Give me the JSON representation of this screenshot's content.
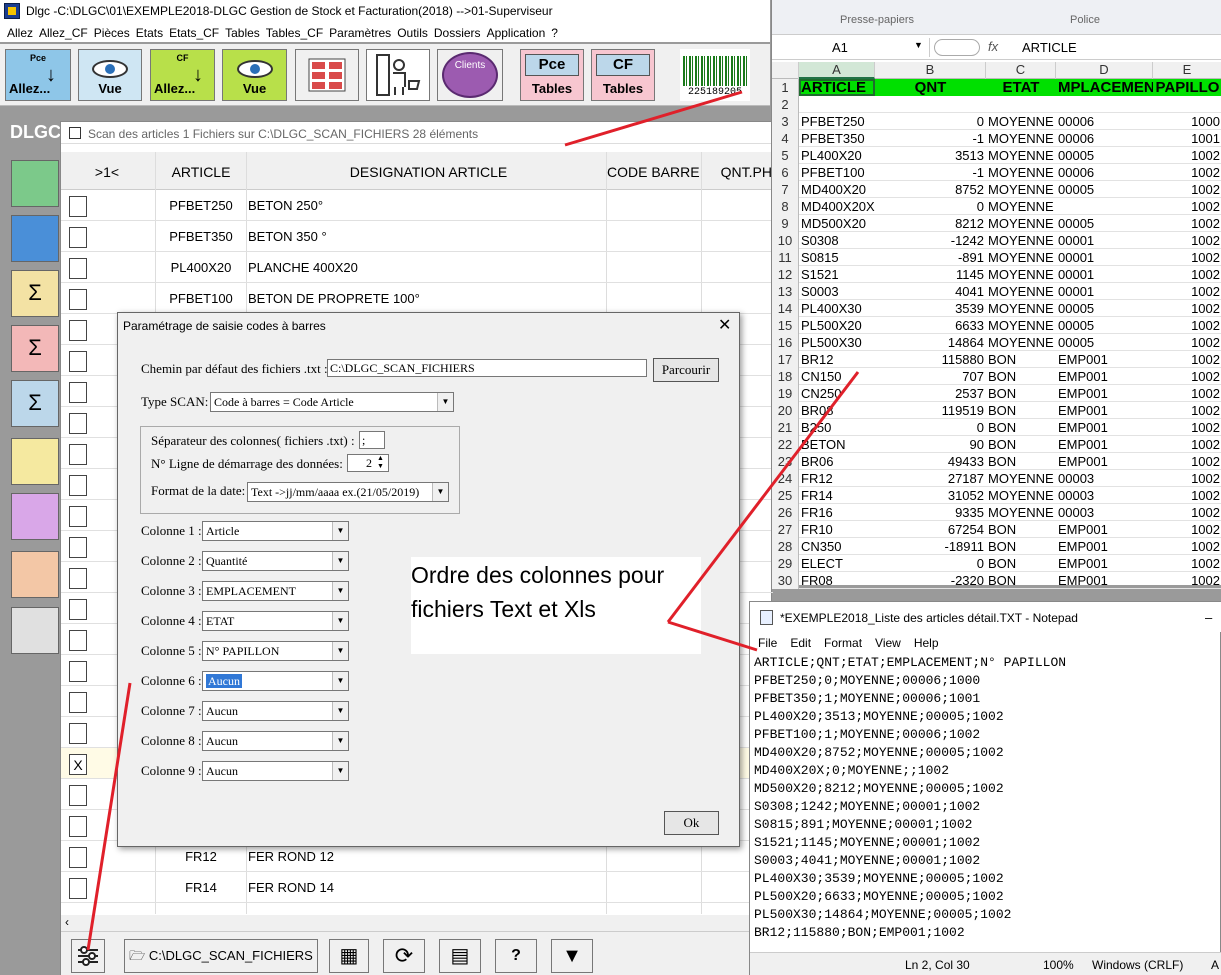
{
  "app": {
    "title": "Dlgc -C:\\DLGC\\01\\EXEMPLE2018-DLGC Gestion de Stock et Facturation(2018) -->01-Superviseur",
    "brand_label": "DLGC",
    "menu": [
      "Allez",
      "Allez_CF",
      "Pièces",
      "Etats",
      "Etats_CF",
      "Tables",
      "Tables_CF",
      "Paramètres",
      "Outils",
      "Dossiers",
      "Application",
      "?"
    ]
  },
  "toolbar": {
    "allez_pce_small": "Pce",
    "allez_pce_label": "Allez...",
    "vue_label": "Vue",
    "allez_cf_small": "CF",
    "allez_cf_label": "Allez...",
    "vue_cf_label": "Vue",
    "clients_label": "Clients",
    "pce_tables_top": "Pce",
    "pce_tables_bottom": "Tables",
    "cf_tables_top": "CF",
    "cf_tables_bottom": "Tables",
    "barcode_number": "225189205"
  },
  "scan_window": {
    "title": "Scan des articles 1  Fichiers sur C:\\DLGC_SCAN_FICHIERS   28 éléments",
    "columns": [
      ">1<",
      "ARTICLE",
      "DESIGNATION ARTICLE",
      "CODE BARRES",
      "QNT.PHY"
    ],
    "rows_top": [
      {
        "article": "PFBET250",
        "designation": "BETON 250°"
      },
      {
        "article": "PFBET350",
        "designation": "BETON 350 °"
      },
      {
        "article": "PL400X20",
        "designation": "PLANCHE 400X20"
      },
      {
        "article": "PFBET100",
        "designation": "BETON DE PROPRETE 100°"
      }
    ],
    "checked_mark": "X",
    "rows_bottom": [
      {
        "article": "FR12",
        "designation": "FER ROND 12"
      },
      {
        "article": "FR14",
        "designation": "FER ROND 14"
      }
    ],
    "folder_button": "C:\\DLGC_SCAN_FICHIERS",
    "help_button": "?"
  },
  "dialog": {
    "title": "Paramétrage de saisie codes à barres",
    "close": "✕",
    "path_label": "Chemin par défaut des fichiers .txt :",
    "path_value": "C:\\DLGC_SCAN_FICHIERS",
    "browse_button": "Parcourir",
    "type_label": "Type SCAN:",
    "type_value": "Code à barres = Code Article",
    "separator_label": "Séparateur des colonnes( fichiers .txt) :",
    "separator_value": ";",
    "start_line_label": "N° Ligne de démarrage des données:",
    "start_line_value": "2",
    "date_format_label": "Format de la date:",
    "date_format_value": "Text ->jj/mm/aaaa ex.(21/05/2019)",
    "columns": [
      {
        "label": "Colonne 1 :",
        "value": "Article"
      },
      {
        "label": "Colonne 2 :",
        "value": "Quantité"
      },
      {
        "label": "Colonne 3 :",
        "value": "EMPLACEMENT"
      },
      {
        "label": "Colonne 4 :",
        "value": "ETAT"
      },
      {
        "label": "Colonne 5 :",
        "value": "N° PAPILLON"
      },
      {
        "label": "Colonne 6 :",
        "value": "Aucun"
      },
      {
        "label": "Colonne 7 :",
        "value": "Aucun"
      },
      {
        "label": "Colonne 8 :",
        "value": "Aucun"
      },
      {
        "label": "Colonne 9 :",
        "value": "Aucun"
      }
    ],
    "ok_button": "Ok"
  },
  "annotation": {
    "line1": "Ordre des colonnes pour",
    "line2": "fichiers Text et Xls"
  },
  "excel": {
    "ribbon_left": "Presse-papiers",
    "ribbon_right": "Police",
    "name_box": "A1",
    "fx": "fx",
    "formula": "ARTICLE",
    "col_letters": [
      "A",
      "B",
      "C",
      "D",
      "E"
    ],
    "header_row": [
      "ARTICLE",
      "QNT",
      "ETAT",
      "MPLACEMEN",
      "PAPILLO"
    ],
    "rows": [
      [
        "",
        "",
        "",
        "",
        ""
      ],
      [
        "PFBET250",
        "0",
        "MOYENNE",
        "00006",
        "1000"
      ],
      [
        "PFBET350",
        "-1",
        "MOYENNE",
        "00006",
        "1001"
      ],
      [
        "PL400X20",
        "3513",
        "MOYENNE",
        "00005",
        "1002"
      ],
      [
        "PFBET100",
        "-1",
        "MOYENNE",
        "00006",
        "1002"
      ],
      [
        "MD400X20",
        "8752",
        "MOYENNE",
        "00005",
        "1002"
      ],
      [
        "MD400X20X",
        "0",
        "MOYENNE",
        "",
        "1002"
      ],
      [
        "MD500X20",
        "8212",
        "MOYENNE",
        "00005",
        "1002"
      ],
      [
        "S0308",
        "-1242",
        "MOYENNE",
        "00001",
        "1002"
      ],
      [
        "S0815",
        "-891",
        "MOYENNE",
        "00001",
        "1002"
      ],
      [
        "S1521",
        "1145",
        "MOYENNE",
        "00001",
        "1002"
      ],
      [
        "S0003",
        "4041",
        "MOYENNE",
        "00001",
        "1002"
      ],
      [
        "PL400X30",
        "3539",
        "MOYENNE",
        "00005",
        "1002"
      ],
      [
        "PL500X20",
        "6633",
        "MOYENNE",
        "00005",
        "1002"
      ],
      [
        "PL500X30",
        "14864",
        "MOYENNE",
        "00005",
        "1002"
      ],
      [
        "BR12",
        "115880",
        "BON",
        "EMP001",
        "1002"
      ],
      [
        "CN150",
        "707",
        "BON",
        "EMP001",
        "1002"
      ],
      [
        "CN250",
        "2537",
        "BON",
        "EMP001",
        "1002"
      ],
      [
        "BR08",
        "119519",
        "BON",
        "EMP001",
        "1002"
      ],
      [
        "B250",
        "0",
        "BON",
        "EMP001",
        "1002"
      ],
      [
        "BETON",
        "90",
        "BON",
        "EMP001",
        "1002"
      ],
      [
        "BR06",
        "49433",
        "BON",
        "EMP001",
        "1002"
      ],
      [
        "FR12",
        "27187",
        "MOYENNE",
        "00003",
        "1002"
      ],
      [
        "FR14",
        "31052",
        "MOYENNE",
        "00003",
        "1002"
      ],
      [
        "FR16",
        "9335",
        "MOYENNE",
        "00003",
        "1002"
      ],
      [
        "FR10",
        "67254",
        "BON",
        "EMP001",
        "1002"
      ],
      [
        "CN350",
        "-18911",
        "BON",
        "EMP001",
        "1002"
      ],
      [
        "ELECT",
        "0",
        "BON",
        "EMP001",
        "1002"
      ],
      [
        "FR08",
        "-2320",
        "BON",
        "EMP001",
        "1002"
      ]
    ]
  },
  "notepad": {
    "title": "*EXEMPLE2018_Liste des articles détail.TXT - Notepad",
    "menu": [
      "File",
      "Edit",
      "Format",
      "View",
      "Help"
    ],
    "lines": [
      "ARTICLE;QNT;ETAT;EMPLACEMENT;N° PAPILLON",
      "PFBET250;0;MOYENNE;00006;1000",
      "PFBET350;1;MOYENNE;00006;1001",
      "PL400X20;3513;MOYENNE;00005;1002",
      "PFBET100;1;MOYENNE;00006;1002",
      "MD400X20;8752;MOYENNE;00005;1002",
      "MD400X20X;0;MOYENNE;;1002",
      "MD500X20;8212;MOYENNE;00005;1002",
      "S0308;1242;MOYENNE;00001;1002",
      "S0815;891;MOYENNE;00001;1002",
      "S1521;1145;MOYENNE;00001;1002",
      "S0003;4041;MOYENNE;00001;1002",
      "PL400X30;3539;MOYENNE;00005;1002",
      "PL500X20;6633;MOYENNE;00005;1002",
      "PL500X30;14864;MOYENNE;00005;1002",
      "BR12;115880;BON;EMP001;1002"
    ],
    "status_pos": "Ln 2, Col 30",
    "status_zoom": "100%",
    "status_eol": "Windows (CRLF)",
    "status_enc": "A"
  },
  "colors": {
    "excel_header_green": "#00e000",
    "annotation_red": "#e0202a",
    "selection_blue": "#3178d6"
  }
}
